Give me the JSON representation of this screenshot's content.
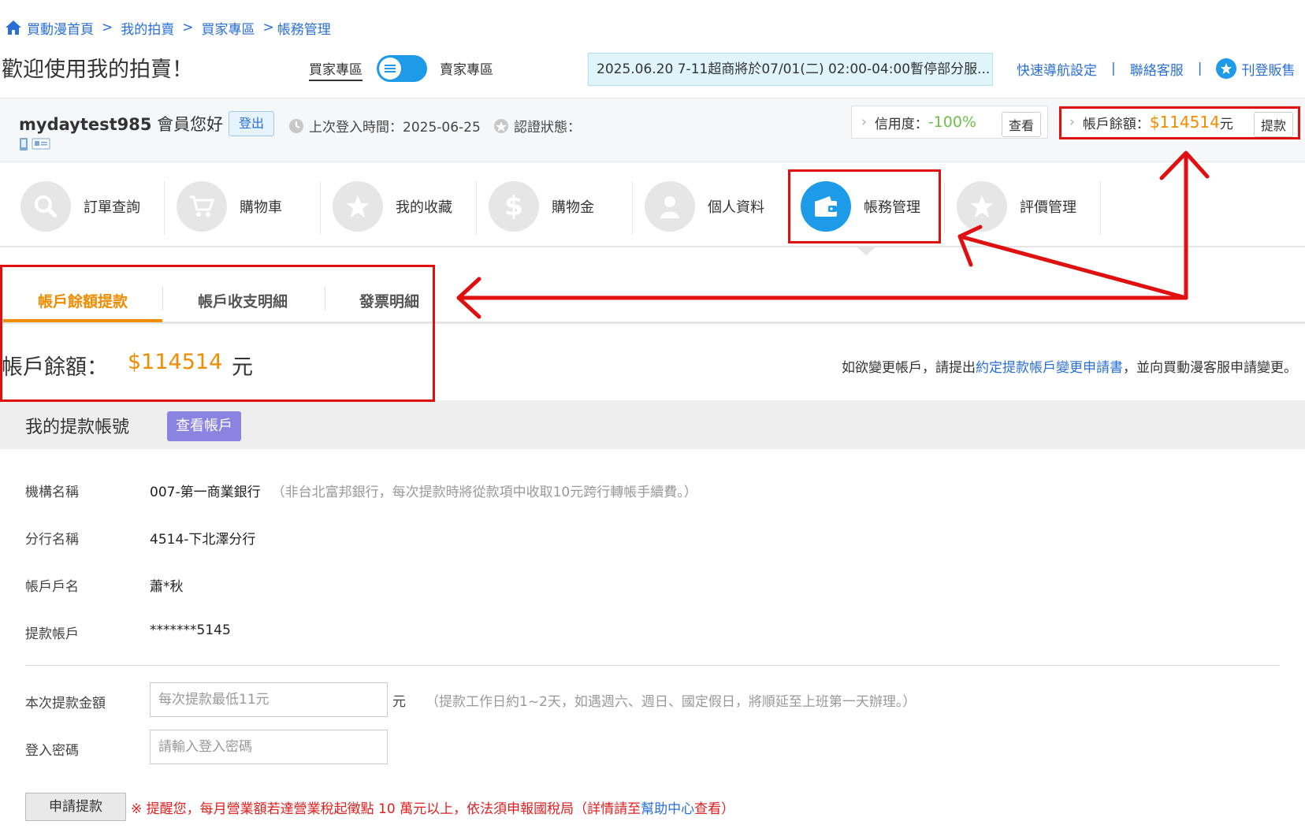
{
  "breadcrumb": {
    "items": [
      "買動漫首頁",
      "我的拍賣",
      "買家專區",
      "帳務管理"
    ],
    "sep": ">"
  },
  "header": {
    "welcome": "歡迎使用我的拍賣！",
    "buyer_zone": "買家專區",
    "seller_zone": "賣家專區",
    "notice": "2025.06.20 7-11超商將於07/01(二) 02:00-04:00暫停部分服...",
    "links": {
      "quick_nav": "快速導航設定",
      "contact": "聯絡客服",
      "post_sale": "刊登販售",
      "bar": "|"
    }
  },
  "member": {
    "name": "mydaytest985",
    "hello": " 會員您好",
    "logout": "登出",
    "last_login": "上次登入時間：2025-06-25",
    "cert_status": "認證狀態：",
    "credit_label": "信用度：",
    "credit_value": "-100%",
    "credit_view": "查看",
    "balance_label": "帳戶餘額：",
    "balance_value": "$114514",
    "balance_unit": " 元",
    "withdraw_btn": "提款"
  },
  "nav": {
    "items": [
      {
        "label": "訂單查詢",
        "icon": "search-icon"
      },
      {
        "label": "購物車",
        "icon": "cart-icon"
      },
      {
        "label": "我的收藏",
        "icon": "star-icon"
      },
      {
        "label": "購物金",
        "icon": "dollar-icon"
      },
      {
        "label": "個人資料",
        "icon": "user-icon"
      },
      {
        "label": "帳務管理",
        "icon": "wallet-icon"
      },
      {
        "label": "評價管理",
        "icon": "rating-star-icon"
      }
    ],
    "active": "帳務管理"
  },
  "tabs": {
    "items": [
      "帳戶餘額提款",
      "帳戶收支明細",
      "發票明細"
    ],
    "active": "帳戶餘額提款"
  },
  "balance": {
    "label": "帳戶餘額：",
    "amount": "$114514",
    "unit": "元",
    "change_note_prefix": "如欲變更帳戶，請提出",
    "change_note_link": "約定提款帳戶變更申請書",
    "change_note_suffix": "，並向買動漫客服申請變更。"
  },
  "account": {
    "title": "我的提款帳號",
    "view_btn": "查看帳戶",
    "rows": [
      {
        "label": "機構名稱",
        "value": "007-第一商業銀行",
        "note": "（非台北富邦銀行，每次提款時將從款項中收取10元跨行轉帳手續費。）"
      },
      {
        "label": "分行名稱",
        "value": "4514-下北澤分行",
        "note": ""
      },
      {
        "label": "帳戶戶名",
        "value": "蕭*秋",
        "note": ""
      },
      {
        "label": "提款帳戶",
        "value": "*******5145",
        "note": ""
      }
    ]
  },
  "form": {
    "amount_label": "本次提款金額",
    "amount_placeholder": "每次提款最低11元",
    "amount_unit": "元",
    "amount_note": "（提款工作日約1~2天，如遇週六、週日、國定假日，將順延至上班第一天辦理。）",
    "password_label": "登入密碼",
    "password_placeholder": "請輸入登入密碼",
    "apply_btn": "申請提款",
    "tax_prefix": "※ 提醒您，每月營業額若達營業稅起徵點 10 萬元以上，依法須申報國稅局（詳情請至",
    "tax_link": "幫助中心",
    "tax_suffix": "查看）"
  },
  "colors": {
    "accent_blue": "#1e9be8",
    "link_blue": "#2a6fd6",
    "orange": "#f08c00",
    "annotation_red": "#e01010",
    "credit_green": "#6cc04a"
  }
}
